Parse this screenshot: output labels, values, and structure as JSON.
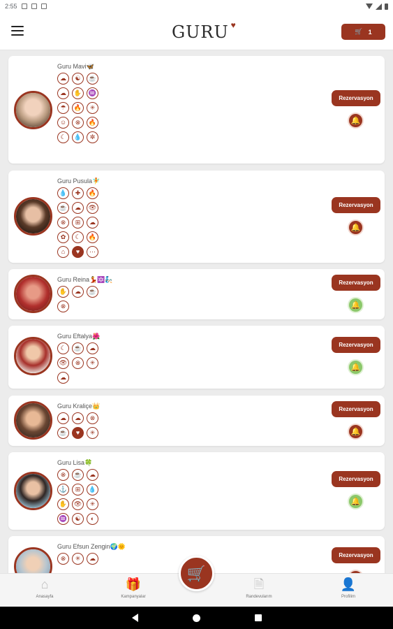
{
  "status_bar": {
    "time": "2:55"
  },
  "header": {
    "logo_text": "GURU",
    "logo_heart": "♥",
    "cart_icon": "🛒",
    "cart_count": "1"
  },
  "reserve_label": "Rezervasyon",
  "gurus": [
    {
      "name": "Guru Mavi🦋",
      "bell": "off",
      "icons": [
        "☁",
        "☯",
        "☕",
        "☁",
        "✋",
        "♒",
        "☂",
        "🔥",
        "✳",
        "☺",
        "⊗",
        "🔥",
        "☾",
        "💧",
        "✼"
      ]
    },
    {
      "name": "Guru Pusula🧚",
      "bell": "off",
      "icons": [
        "💧",
        "✚",
        "🔥",
        "☕",
        "☁",
        "👁",
        "⊗",
        "⊞",
        "☁",
        "✿",
        "☾",
        "🔥",
        "⌂",
        "♥",
        "⋯"
      ]
    },
    {
      "name": "Guru Reina💃🔯🧞",
      "bell": "on",
      "icons": [
        "✋",
        "☁",
        "☕",
        "⊗"
      ]
    },
    {
      "name": "Guru Eftalya🌺",
      "bell": "on",
      "icons": [
        "☾",
        "☕",
        "☁",
        "👁",
        "⊗",
        "✳",
        "☁"
      ]
    },
    {
      "name": "Guru Kraliçe👑",
      "bell": "off",
      "icons": [
        "☁",
        "☁",
        "⊗",
        "☕",
        "♥",
        "✳"
      ]
    },
    {
      "name": "Guru Lisa🍀",
      "bell": "on",
      "icons": [
        "⊗",
        "☕",
        "☁",
        "⚓",
        "⊞",
        "💧",
        "✋",
        "👁",
        "✳",
        "♒",
        "☯",
        "◐"
      ]
    },
    {
      "name": "Guru Efsun Zengin🌍🌞",
      "bell": "off",
      "icons": [
        "⊗",
        "✳",
        "☁"
      ]
    }
  ],
  "nav": {
    "home": "Anasayfa",
    "campaigns": "Kampanyalar",
    "appointments": "Randevularım",
    "profile": "Profilim"
  },
  "colors": {
    "brand": "#9a3520",
    "bell_on": "#8bc86a",
    "background": "#ececec"
  }
}
